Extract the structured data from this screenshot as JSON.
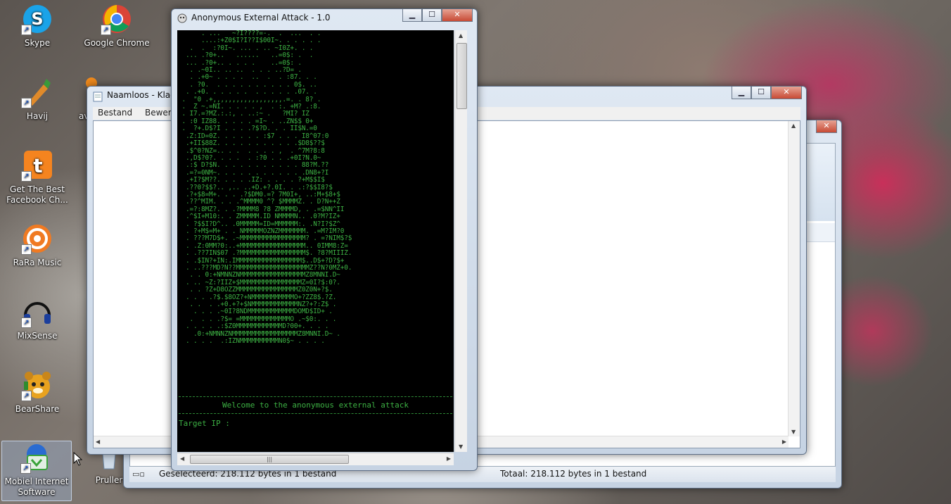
{
  "desktop": {
    "icons": [
      {
        "label": "Skype",
        "icon": "skype-icon",
        "color": "#1aa3e8",
        "glyph": "S"
      },
      {
        "label": "Google Chrome",
        "icon": "chrome-icon",
        "color": "#d9463b",
        "glyph": "◉"
      },
      {
        "label": "Havij",
        "icon": "havij-icon",
        "color": "#e08a2a",
        "glyph": "✎"
      },
      {
        "label": "av",
        "icon": "app-icon",
        "color": "#f08a1c",
        "glyph": "☺"
      },
      {
        "label": "Get The Best Facebook Ch...",
        "icon": "toolbar-icon",
        "color": "#f5841f",
        "glyph": "t"
      },
      {
        "label": "RaRa Music",
        "icon": "rara-music-icon",
        "color": "#f07a22",
        "glyph": "◎"
      },
      {
        "label": "MixSense",
        "icon": "mixsense-icon",
        "color": "#1b3e9c",
        "glyph": "◐"
      },
      {
        "label": "BearShare",
        "icon": "bearshare-icon",
        "color": "#e8a21f",
        "glyph": "☻"
      },
      {
        "label": "Mobiel Internet Software",
        "icon": "mobile-internet-icon",
        "color": "#2a6bd1",
        "glyph": "✆"
      },
      {
        "label": "Pruller",
        "icon": "recycle-bin-icon",
        "color": "#9fb5cc",
        "glyph": "♻"
      }
    ]
  },
  "notepad": {
    "title": "Naamloos - Kladbl",
    "menu": [
      "Bestand",
      "Bewerken"
    ]
  },
  "explorer": {
    "status_selected": "Geselecteerd: 218.112 bytes in 1 bestand",
    "status_total": "Totaal: 218.112 bytes in 1 bestand"
  },
  "console": {
    "title": "Anonymous External Attack - 1.0",
    "text_color": "#3cb043",
    "ascii_art": "      . ...   ~?I????=-.  .  ...  . .\n      ....:+Z0$I?I??I$00I~. . . . . .\n   .  .  :?0I~. ... . .. ~I0Z+. . .\n  ... .?0+..   ......   ..=0$: .  .\n  ... .?0+.. . . . .    ..=0$: .\n   . .~0I.. .. ..  . . . ..?D= .\n   . .+0~ . . . .  ..  .  . :87. . .\n   . ?0.  . . . . . . . . . . 0$. ..\n  . .+0. . . . . .  . . . . . .07. .\n .  \"0 .+,,,,,,,,,,,,,,,,,,.=. . 8? .\n .  Z ~.=NI. . . . . ,  . :. +M? .:8.\n . I7.=?MZ.:.:, . ..:~ .   ?MI? IZ\n . :0 IZ88. . . . . =I~ . ..ZN$$ 0+\n .  ?+.D$?I . . . .?$?D. . . II$N.=0\n  .Z:ID=0Z. . . . . . :$7 . . . I8^07:0\n  .+II$88Z. . . . . . . . . . .$D8$??$\n  .$^0?NZ=.. . .  . . . . ,  . ^7M?8:8\n  .,D$?0?. . . .  . :?0 . . .+0I?N.0~\n  .:$ D?$N. . . . . . . . . . . 88?M.??\n  .=?=0NM~. . . . . . . . . . . .DN8+?I\n  .+I?$M??. . . . .IZ: . . . . ?+M$$I$\n  .??0?$$?.. ,.. ..+D.+?.0I. . .:?$$I8?$\n  .?+$8=M+. . . .?$DM0.=? 7M0I+, ..:M+$8+$\n  .??^MIM. . . .^MMMM0 ^? $MMMMZ. . D?N++Z\n  .=?:8MZ?. . .?MMMM8 ?8 ZMMMMD, . .=$NN^II\n  .^$I+M10:. . ZMMMMM.ID NMMMMN.. .0?M?IZ+\n  . ?$$I?D^.. .0MMMMM=ID=MMMMMM:. .N?I?$Z^\n  . ?+M$=M+ . . NMMMMMOZNZMMMMMMM. .=M?IM?0\n  . ???M7D$+. .~MMMMMMMMMMMMMMMMM? . =?NIM$?$\n  . .Z:0MM?0:..+MMMMMMMMMMMMMMMMM.. 0IMM8:Z=\n  . .??7IN$07 .?MMMMMMMMMMMMMMMMM$. ?8?MIIIZ.\n  . .$IN?+IN:.IMMMMMMMMMMMMMMMMM$..D$+?D?$+\n  . ..???MD?N??MMMMMMMMMMMMMMMMMMMZ??N?0MZ+0.\n   . . 0:+NMNNZNMMMMMMMMMMMMMMMMMZ8MNNI.D~\n  . .. ~Z:?IIZ+$MMMMMMMMMMMMMMMMZ=0I?$:0?.\n   . . ?Z+D8OZZMMMMMMMMMMMMMMMMZ0Z0N+?$.\n  . . . .?$.$8OZ?+NMMMMMMMMMMMO+?ZZ8$.?Z.\n   . .  . .+0.+?+$NMMMMMMMMMMMMNZ?+?:Z$ .\n    . . . .~0I?8NDMMMMMMMMMMMMDOMD$ID+ .\n   .  . . .?$= =MMMMMMMMMMMMMO .~$0:. . .\n  . . . . .:$Z0MMMMMMMMMMMMD?00+. . . .\n    .0:+NMNNZNMMMMMMMMMMMMMMMMMZ8MNNI.D~ .\n  . . . .  .:IZNMMMMMMMMMMN0$~ . . . .",
    "welcome": "Welcome to the anonymous external attack",
    "prompt": "Target IP :"
  }
}
